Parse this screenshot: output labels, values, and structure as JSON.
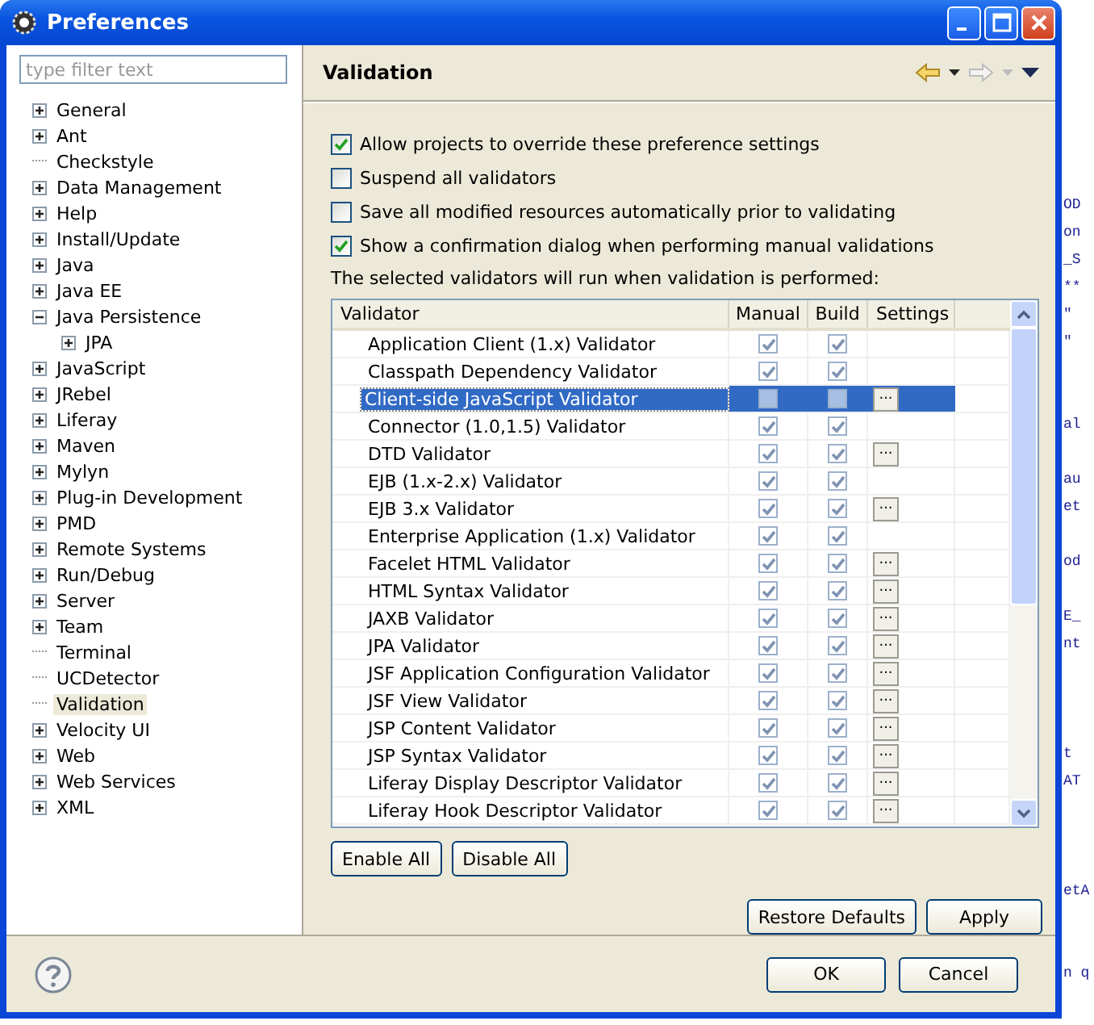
{
  "window": {
    "title": "Preferences"
  },
  "filter": {
    "placeholder": "type filter text"
  },
  "tree": [
    {
      "label": "General",
      "kind": "folder",
      "expanded": false,
      "selected": false
    },
    {
      "label": "Ant",
      "kind": "folder",
      "expanded": false,
      "selected": false
    },
    {
      "label": "Checkstyle",
      "kind": "leaf",
      "selected": false
    },
    {
      "label": "Data Management",
      "kind": "folder",
      "expanded": false,
      "selected": false
    },
    {
      "label": "Help",
      "kind": "folder",
      "expanded": false,
      "selected": false
    },
    {
      "label": "Install/Update",
      "kind": "folder",
      "expanded": false,
      "selected": false
    },
    {
      "label": "Java",
      "kind": "folder",
      "expanded": false,
      "selected": false
    },
    {
      "label": "Java EE",
      "kind": "folder",
      "expanded": false,
      "selected": false
    },
    {
      "label": "Java Persistence",
      "kind": "folder",
      "expanded": true,
      "selected": false,
      "children": [
        {
          "label": "JPA",
          "kind": "folder",
          "expanded": false,
          "selected": false
        }
      ]
    },
    {
      "label": "JavaScript",
      "kind": "folder",
      "expanded": false,
      "selected": false
    },
    {
      "label": "JRebel",
      "kind": "folder",
      "expanded": false,
      "selected": false
    },
    {
      "label": "Liferay",
      "kind": "folder",
      "expanded": false,
      "selected": false
    },
    {
      "label": "Maven",
      "kind": "folder",
      "expanded": false,
      "selected": false
    },
    {
      "label": "Mylyn",
      "kind": "folder",
      "expanded": false,
      "selected": false
    },
    {
      "label": "Plug-in Development",
      "kind": "folder",
      "expanded": false,
      "selected": false
    },
    {
      "label": "PMD",
      "kind": "folder",
      "expanded": false,
      "selected": false
    },
    {
      "label": "Remote Systems",
      "kind": "folder",
      "expanded": false,
      "selected": false
    },
    {
      "label": "Run/Debug",
      "kind": "folder",
      "expanded": false,
      "selected": false
    },
    {
      "label": "Server",
      "kind": "folder",
      "expanded": false,
      "selected": false
    },
    {
      "label": "Team",
      "kind": "folder",
      "expanded": false,
      "selected": false
    },
    {
      "label": "Terminal",
      "kind": "leaf",
      "selected": false
    },
    {
      "label": "UCDetector",
      "kind": "leaf",
      "selected": false
    },
    {
      "label": "Validation",
      "kind": "leaf",
      "selected": true
    },
    {
      "label": "Velocity UI",
      "kind": "folder",
      "expanded": false,
      "selected": false
    },
    {
      "label": "Web",
      "kind": "folder",
      "expanded": false,
      "selected": false
    },
    {
      "label": "Web Services",
      "kind": "folder",
      "expanded": false,
      "selected": false
    },
    {
      "label": "XML",
      "kind": "folder",
      "expanded": false,
      "selected": false
    }
  ],
  "page": {
    "title": "Validation",
    "options": [
      {
        "label": "Allow projects to override these preference settings",
        "checked": true
      },
      {
        "label": "Suspend all validators",
        "checked": false
      },
      {
        "label": "Save all modified resources automatically prior to validating",
        "checked": false
      },
      {
        "label": "Show a confirmation dialog when performing manual validations",
        "checked": true
      }
    ],
    "table_caption": "The selected validators will run when validation is performed:",
    "table": {
      "columns": [
        "Validator",
        "Manual",
        "Build",
        "Settings"
      ],
      "rows": [
        {
          "name": "Application Client (1.x) Validator",
          "manual": true,
          "build": true,
          "settings": false,
          "selected": false
        },
        {
          "name": "Classpath Dependency Validator",
          "manual": true,
          "build": true,
          "settings": false,
          "selected": false
        },
        {
          "name": "Client-side JavaScript Validator",
          "manual": false,
          "build": false,
          "settings": true,
          "selected": true
        },
        {
          "name": "Connector (1.0,1.5) Validator",
          "manual": true,
          "build": true,
          "settings": false,
          "selected": false
        },
        {
          "name": "DTD Validator",
          "manual": true,
          "build": true,
          "settings": true,
          "selected": false
        },
        {
          "name": "EJB (1.x-2.x) Validator",
          "manual": true,
          "build": true,
          "settings": false,
          "selected": false
        },
        {
          "name": "EJB 3.x Validator",
          "manual": true,
          "build": true,
          "settings": true,
          "selected": false
        },
        {
          "name": "Enterprise Application (1.x) Validator",
          "manual": true,
          "build": true,
          "settings": false,
          "selected": false
        },
        {
          "name": "Facelet HTML Validator",
          "manual": true,
          "build": true,
          "settings": true,
          "selected": false
        },
        {
          "name": "HTML Syntax Validator",
          "manual": true,
          "build": true,
          "settings": true,
          "selected": false
        },
        {
          "name": "JAXB Validator",
          "manual": true,
          "build": true,
          "settings": true,
          "selected": false
        },
        {
          "name": "JPA Validator",
          "manual": true,
          "build": true,
          "settings": true,
          "selected": false
        },
        {
          "name": "JSF Application Configuration Validator",
          "manual": true,
          "build": true,
          "settings": true,
          "selected": false
        },
        {
          "name": "JSF View Validator",
          "manual": true,
          "build": true,
          "settings": true,
          "selected": false
        },
        {
          "name": "JSP Content Validator",
          "manual": true,
          "build": true,
          "settings": true,
          "selected": false
        },
        {
          "name": "JSP Syntax Validator",
          "manual": true,
          "build": true,
          "settings": true,
          "selected": false
        },
        {
          "name": "Liferay Display Descriptor Validator",
          "manual": true,
          "build": true,
          "settings": true,
          "selected": false
        },
        {
          "name": "Liferay Hook Descriptor Validator",
          "manual": true,
          "build": true,
          "settings": true,
          "selected": false
        }
      ],
      "settings_button": "..."
    },
    "table_buttons": [
      "Enable All",
      "Disable All"
    ],
    "page_buttons": [
      "Restore Defaults",
      "Apply"
    ]
  },
  "dialog_buttons": [
    "OK",
    "Cancel"
  ],
  "background_editor": [
    "OD",
    "on",
    "_S",
    "**",
    "\"",
    "\"",
    "al",
    "au",
    "et",
    "od",
    "E_",
    "nt",
    "t",
    "AT",
    "etA",
    "n q"
  ]
}
